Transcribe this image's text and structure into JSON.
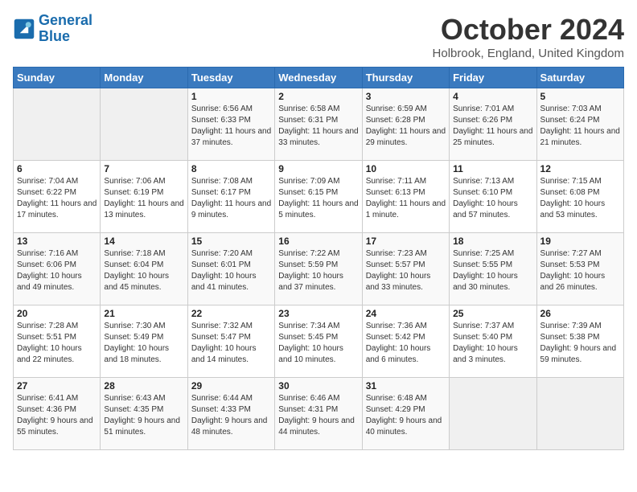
{
  "header": {
    "logo_line1": "General",
    "logo_line2": "Blue",
    "month": "October 2024",
    "location": "Holbrook, England, United Kingdom"
  },
  "weekdays": [
    "Sunday",
    "Monday",
    "Tuesday",
    "Wednesday",
    "Thursday",
    "Friday",
    "Saturday"
  ],
  "weeks": [
    [
      {
        "day": "",
        "info": ""
      },
      {
        "day": "",
        "info": ""
      },
      {
        "day": "1",
        "info": "Sunrise: 6:56 AM\nSunset: 6:33 PM\nDaylight: 11 hours and 37 minutes."
      },
      {
        "day": "2",
        "info": "Sunrise: 6:58 AM\nSunset: 6:31 PM\nDaylight: 11 hours and 33 minutes."
      },
      {
        "day": "3",
        "info": "Sunrise: 6:59 AM\nSunset: 6:28 PM\nDaylight: 11 hours and 29 minutes."
      },
      {
        "day": "4",
        "info": "Sunrise: 7:01 AM\nSunset: 6:26 PM\nDaylight: 11 hours and 25 minutes."
      },
      {
        "day": "5",
        "info": "Sunrise: 7:03 AM\nSunset: 6:24 PM\nDaylight: 11 hours and 21 minutes."
      }
    ],
    [
      {
        "day": "6",
        "info": "Sunrise: 7:04 AM\nSunset: 6:22 PM\nDaylight: 11 hours and 17 minutes."
      },
      {
        "day": "7",
        "info": "Sunrise: 7:06 AM\nSunset: 6:19 PM\nDaylight: 11 hours and 13 minutes."
      },
      {
        "day": "8",
        "info": "Sunrise: 7:08 AM\nSunset: 6:17 PM\nDaylight: 11 hours and 9 minutes."
      },
      {
        "day": "9",
        "info": "Sunrise: 7:09 AM\nSunset: 6:15 PM\nDaylight: 11 hours and 5 minutes."
      },
      {
        "day": "10",
        "info": "Sunrise: 7:11 AM\nSunset: 6:13 PM\nDaylight: 11 hours and 1 minute."
      },
      {
        "day": "11",
        "info": "Sunrise: 7:13 AM\nSunset: 6:10 PM\nDaylight: 10 hours and 57 minutes."
      },
      {
        "day": "12",
        "info": "Sunrise: 7:15 AM\nSunset: 6:08 PM\nDaylight: 10 hours and 53 minutes."
      }
    ],
    [
      {
        "day": "13",
        "info": "Sunrise: 7:16 AM\nSunset: 6:06 PM\nDaylight: 10 hours and 49 minutes."
      },
      {
        "day": "14",
        "info": "Sunrise: 7:18 AM\nSunset: 6:04 PM\nDaylight: 10 hours and 45 minutes."
      },
      {
        "day": "15",
        "info": "Sunrise: 7:20 AM\nSunset: 6:01 PM\nDaylight: 10 hours and 41 minutes."
      },
      {
        "day": "16",
        "info": "Sunrise: 7:22 AM\nSunset: 5:59 PM\nDaylight: 10 hours and 37 minutes."
      },
      {
        "day": "17",
        "info": "Sunrise: 7:23 AM\nSunset: 5:57 PM\nDaylight: 10 hours and 33 minutes."
      },
      {
        "day": "18",
        "info": "Sunrise: 7:25 AM\nSunset: 5:55 PM\nDaylight: 10 hours and 30 minutes."
      },
      {
        "day": "19",
        "info": "Sunrise: 7:27 AM\nSunset: 5:53 PM\nDaylight: 10 hours and 26 minutes."
      }
    ],
    [
      {
        "day": "20",
        "info": "Sunrise: 7:28 AM\nSunset: 5:51 PM\nDaylight: 10 hours and 22 minutes."
      },
      {
        "day": "21",
        "info": "Sunrise: 7:30 AM\nSunset: 5:49 PM\nDaylight: 10 hours and 18 minutes."
      },
      {
        "day": "22",
        "info": "Sunrise: 7:32 AM\nSunset: 5:47 PM\nDaylight: 10 hours and 14 minutes."
      },
      {
        "day": "23",
        "info": "Sunrise: 7:34 AM\nSunset: 5:45 PM\nDaylight: 10 hours and 10 minutes."
      },
      {
        "day": "24",
        "info": "Sunrise: 7:36 AM\nSunset: 5:42 PM\nDaylight: 10 hours and 6 minutes."
      },
      {
        "day": "25",
        "info": "Sunrise: 7:37 AM\nSunset: 5:40 PM\nDaylight: 10 hours and 3 minutes."
      },
      {
        "day": "26",
        "info": "Sunrise: 7:39 AM\nSunset: 5:38 PM\nDaylight: 9 hours and 59 minutes."
      }
    ],
    [
      {
        "day": "27",
        "info": "Sunrise: 6:41 AM\nSunset: 4:36 PM\nDaylight: 9 hours and 55 minutes."
      },
      {
        "day": "28",
        "info": "Sunrise: 6:43 AM\nSunset: 4:35 PM\nDaylight: 9 hours and 51 minutes."
      },
      {
        "day": "29",
        "info": "Sunrise: 6:44 AM\nSunset: 4:33 PM\nDaylight: 9 hours and 48 minutes."
      },
      {
        "day": "30",
        "info": "Sunrise: 6:46 AM\nSunset: 4:31 PM\nDaylight: 9 hours and 44 minutes."
      },
      {
        "day": "31",
        "info": "Sunrise: 6:48 AM\nSunset: 4:29 PM\nDaylight: 9 hours and 40 minutes."
      },
      {
        "day": "",
        "info": ""
      },
      {
        "day": "",
        "info": ""
      }
    ]
  ]
}
